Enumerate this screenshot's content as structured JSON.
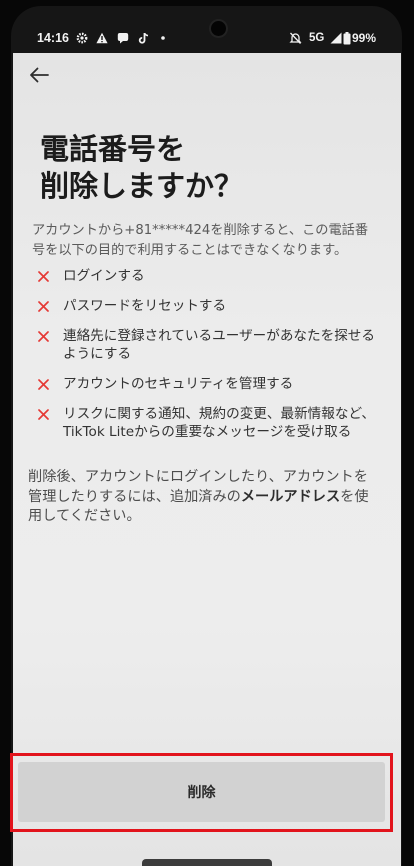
{
  "status_bar": {
    "time": "14:16",
    "left_icons": [
      "gear-icon",
      "warning-icon",
      "chat-icon",
      "tiktok-icon",
      "dot-icon"
    ],
    "right_icons": [
      "mute-icon",
      "signal-icon",
      "battery-icon"
    ],
    "network": "5G",
    "battery": "99%"
  },
  "header": {
    "back_icon": "arrow-left-icon"
  },
  "title_lines": [
    "電話番号を",
    "削除しますか？"
  ],
  "description": "アカウントから+81*****424を削除すると、この電話番号を以下の目的で利用することはできなくなります。",
  "consequences": [
    {
      "icon": "cross-icon",
      "text": "ログインする"
    },
    {
      "icon": "cross-icon",
      "text": "パスワードをリセットする"
    },
    {
      "icon": "cross-icon",
      "text": "連絡先に登録されているユーザーがあなたを探せるようにする"
    },
    {
      "icon": "cross-icon",
      "text": "アカウントのセキュリティを管理する"
    },
    {
      "icon": "cross-icon",
      "text": "リスクに関する通知、規約の変更、最新情報など、TikTok Liteからの重要なメッセージを受け取る"
    }
  ],
  "note": {
    "before": "削除後、アカウントにログインしたり、アカウントを管理したりするには、追加済みの",
    "emphasis": "メールアドレス",
    "after": "を使用してください。"
  },
  "delete_button": {
    "label": "削除"
  },
  "colors": {
    "cross": "#e53935",
    "highlight": "#e2141c",
    "button_bg": "#d2d2d2",
    "text": "#1c1c1c"
  }
}
